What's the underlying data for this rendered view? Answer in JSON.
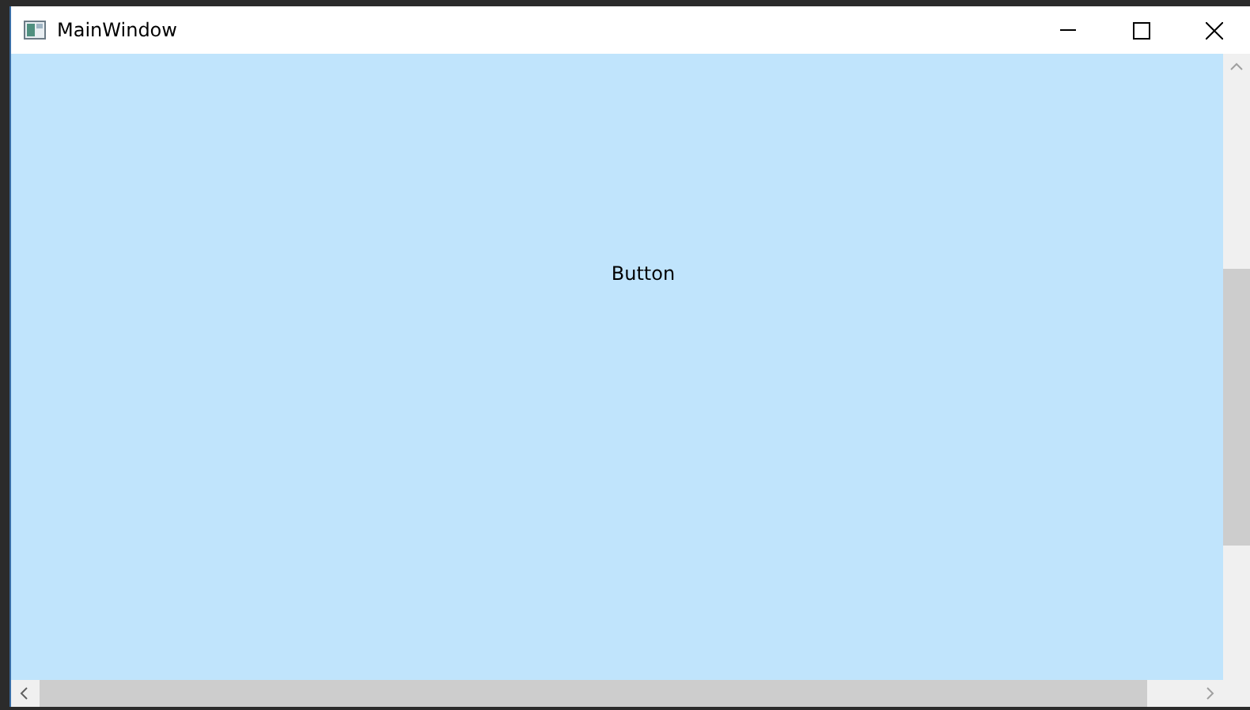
{
  "window": {
    "title": "MainWindow"
  },
  "button": {
    "label": "Button"
  }
}
